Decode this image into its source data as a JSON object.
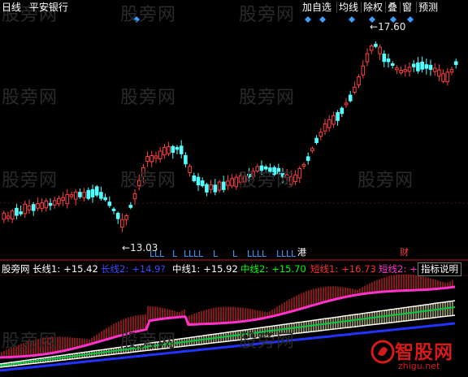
{
  "stock": {
    "period": "日线",
    "name": "平安银行"
  },
  "toolbar": [
    "加自选",
    "均线",
    "除权",
    "叠",
    "窗",
    "预测"
  ],
  "watermark": "股旁网",
  "upper": {
    "high_marker": "17.60",
    "low_marker": "13.03",
    "markers": {
      "l_letter": "L",
      "gang": "港",
      "cai": "财"
    }
  },
  "indicator": {
    "source": "股旁网",
    "values": [
      {
        "label": "长线1:",
        "value": "+15.42",
        "color": "#ffffff"
      },
      {
        "label": "长线2:",
        "value": "+14.9?",
        "color": "#3b4bff"
      },
      {
        "label": "中线1:",
        "value": "+15.92",
        "color": "#ffffff"
      },
      {
        "label": "中线2:",
        "value": "+15.70",
        "color": "#00ff00"
      },
      {
        "label": "短线1:",
        "value": "+16.73",
        "color": "#ff3030"
      },
      {
        "label": "短线2:",
        "value": "+",
        "color": "#ff33cc"
      }
    ],
    "help_label": "指标说明"
  },
  "logo": {
    "text": "智股网",
    "url": "zhigu.net"
  },
  "colors": {
    "up": "#ff4040",
    "down": "#54ffff",
    "bg": "#000000",
    "marker": "#3aa0ff"
  }
}
